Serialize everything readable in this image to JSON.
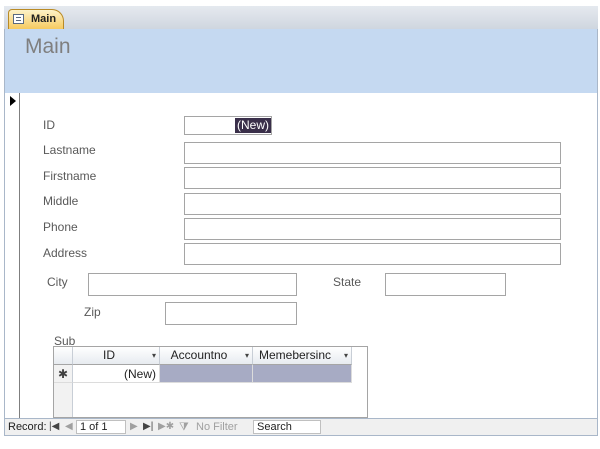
{
  "tab": {
    "label": "Main",
    "icon": "form-icon"
  },
  "form": {
    "title": "Main",
    "fields": {
      "id": {
        "label": "ID",
        "value": "(New)"
      },
      "lastname": {
        "label": "Lastname",
        "value": ""
      },
      "firstname": {
        "label": "Firstname",
        "value": ""
      },
      "middle": {
        "label": "Middle",
        "value": ""
      },
      "phone": {
        "label": "Phone",
        "value": ""
      },
      "address": {
        "label": "Address",
        "value": ""
      },
      "city": {
        "label": "City",
        "value": ""
      },
      "state": {
        "label": "State",
        "value": ""
      },
      "zip": {
        "label": "Zip",
        "value": ""
      }
    }
  },
  "subform": {
    "label": "Sub",
    "columns": [
      "ID",
      "Accountno",
      "Memebersinc"
    ],
    "new_row": {
      "selector": "✱",
      "id": "(New)",
      "accountno": "",
      "memebersinc": ""
    }
  },
  "navbar": {
    "record_label": "Record:",
    "current": "1 of 1",
    "first_glyph": "|◀",
    "prev_glyph": "◀",
    "next_glyph": "▶",
    "last_glyph": "▶|",
    "new_glyph": "▶✱",
    "filter_label": "No Filter",
    "search_placeholder": "Search"
  }
}
